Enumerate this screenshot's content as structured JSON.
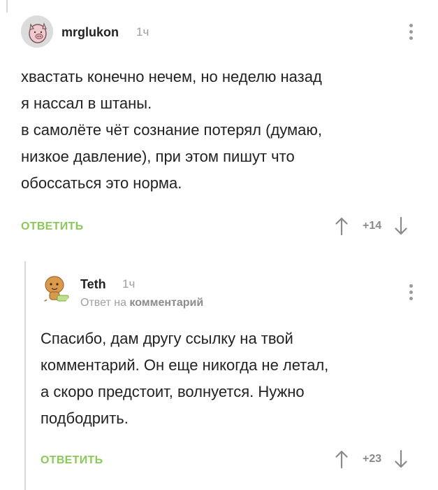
{
  "comments": [
    {
      "username": "mrglukon",
      "time": "1ч",
      "text": [
        "хвастать конечно нечем, но неделю назад",
        "я нассал в штаны.",
        "в самолёте чёт сознание потерял (думаю,",
        "низкое давление), при этом пишут что",
        "обоссаться это норма."
      ],
      "reply_label": "ОТВЕТИТЬ",
      "rating": "+14"
    },
    {
      "username": "Teth",
      "time": "1ч",
      "reply_prefix": "Ответ на",
      "reply_target": "комментарий",
      "text": [
        "Спасибо, дам другу ссылку на твой",
        "комментарий. Он еще никогда не летал,",
        "а скоро предстоит, волнуется. Нужно",
        "подбодрить."
      ],
      "reply_label": "ОТВЕТИТЬ",
      "rating": "+23"
    }
  ],
  "colors": {
    "accent": "#8ac858",
    "muted": "#9e9e9e",
    "thread_line": "#d9d9d9"
  },
  "icons": {
    "upvote": "arrow-up-icon",
    "downvote": "arrow-down-icon",
    "more": "more-vertical-icon"
  }
}
